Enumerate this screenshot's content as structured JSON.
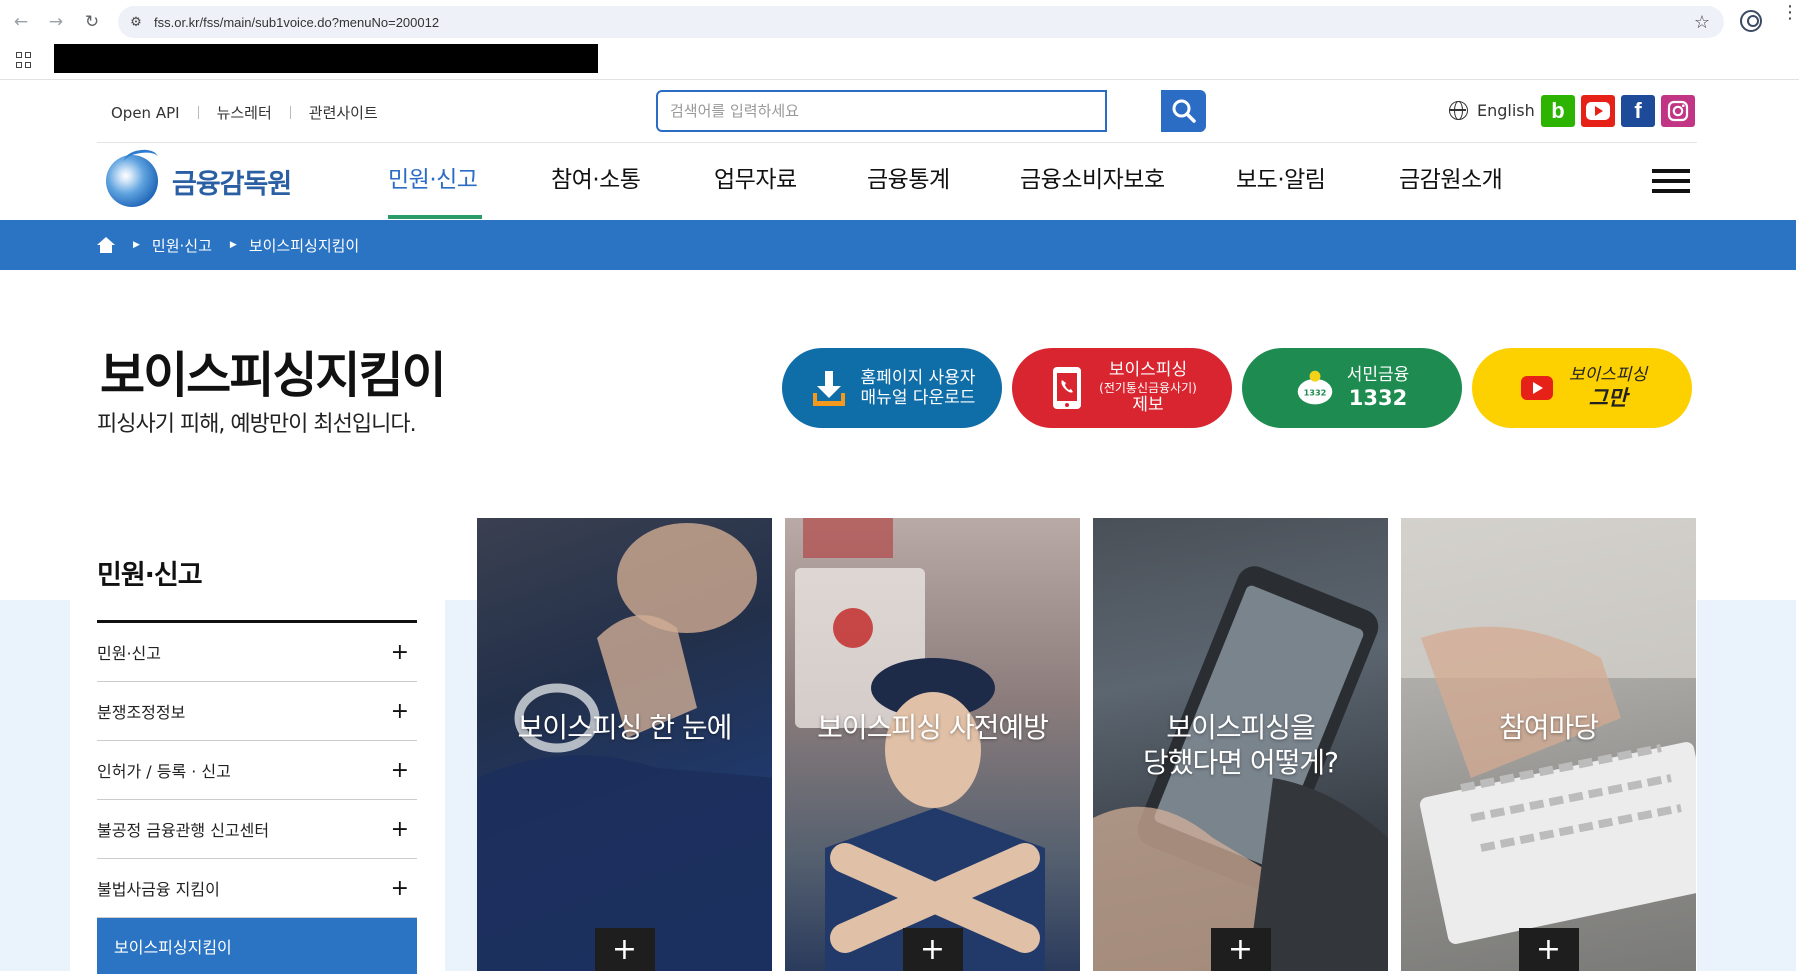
{
  "browser": {
    "url": "fss.or.kr/fss/main/sub1voice.do?menuNo=200012"
  },
  "util": {
    "links": [
      "Open API",
      "뉴스레터",
      "관련사이트"
    ],
    "search_placeholder": "검색어를 입력하세요",
    "language": "English",
    "sns": [
      {
        "name": "blog",
        "glyph": "b",
        "color": "#2db400"
      },
      {
        "name": "youtube",
        "glyph": "▶",
        "color": "#e62117"
      },
      {
        "name": "facebook",
        "glyph": "f",
        "color": "#1d4b9a"
      },
      {
        "name": "instagram",
        "glyph": "◎",
        "color": "#c13584"
      }
    ]
  },
  "logo": {
    "text": "금융감독원"
  },
  "gnb": {
    "items": [
      "민원·신고",
      "참여·소통",
      "업무자료",
      "금융통계",
      "금융소비자보호",
      "보도·알림",
      "금감원소개"
    ],
    "active_index": 0
  },
  "breadcrumb": {
    "items": [
      "민원·신고",
      "보이스피싱지킴이"
    ]
  },
  "page": {
    "title": "보이스피싱지킴이",
    "subtitle": "피싱사기 피해, 예방만이 최선입니다."
  },
  "quick_buttons": [
    {
      "line1": "홈페이지 사용자",
      "line2": "매뉴얼 다운로드",
      "color": "#0f6da8",
      "icon": "download-icon"
    },
    {
      "line1": "보이스피싱",
      "small": "(전기통신금융사기)",
      "line2": "제보",
      "color": "#d9252f",
      "icon": "phone-icon"
    },
    {
      "line1": "서민금융",
      "line2": "1332",
      "color": "#1e8c50",
      "icon": "piggy-bank-icon"
    },
    {
      "line1": "보이스피싱",
      "line2": "그만",
      "color": "#fdd000",
      "icon": "youtube-icon"
    }
  ],
  "side_menu": {
    "title": "민원·신고",
    "items": [
      "민원·신고",
      "분쟁조정정보",
      "인허가 / 등록 · 신고",
      "불공정 금융관행 신고센터",
      "불법사금융 지킴이",
      "보이스피싱지킴이"
    ],
    "active_index": 5
  },
  "cards": [
    {
      "title": "보이스피싱 한 눈에"
    },
    {
      "title": "보이스피싱 사전예방"
    },
    {
      "title_line1": "보이스피싱을",
      "title_line2": "당했다면 어떻게?"
    },
    {
      "title": "참여마당"
    }
  ]
}
